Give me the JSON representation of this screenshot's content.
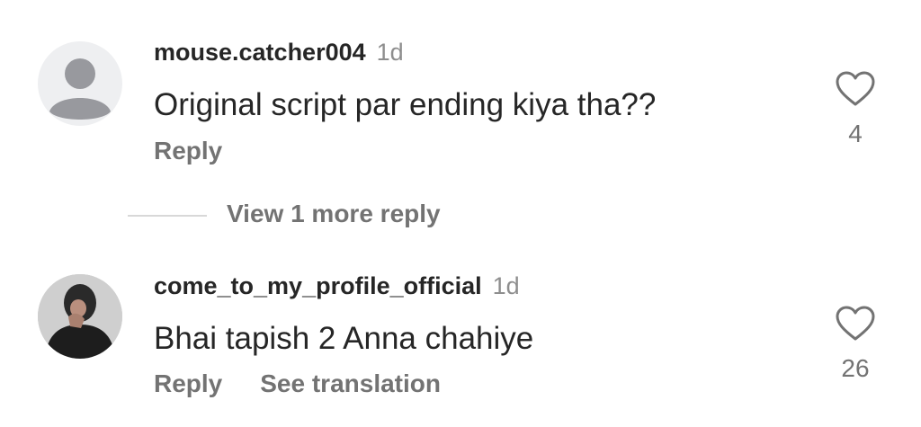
{
  "comments": [
    {
      "username": "mouse.catcher004",
      "time": "1d",
      "text": "Original script par ending kiya tha??",
      "reply_label": "Reply",
      "likes": "4",
      "avatar": "default-avatar",
      "icon": "heart-outline"
    },
    {
      "username": "come_to_my_profile_official",
      "time": "1d",
      "text": "Bhai tapish 2 Anna chahiye",
      "reply_label": "Reply",
      "translate_label": "See translation",
      "likes": "26",
      "avatar": "profile-photo",
      "icon": "heart-outline"
    }
  ],
  "view_more_replies": "View 1 more reply"
}
